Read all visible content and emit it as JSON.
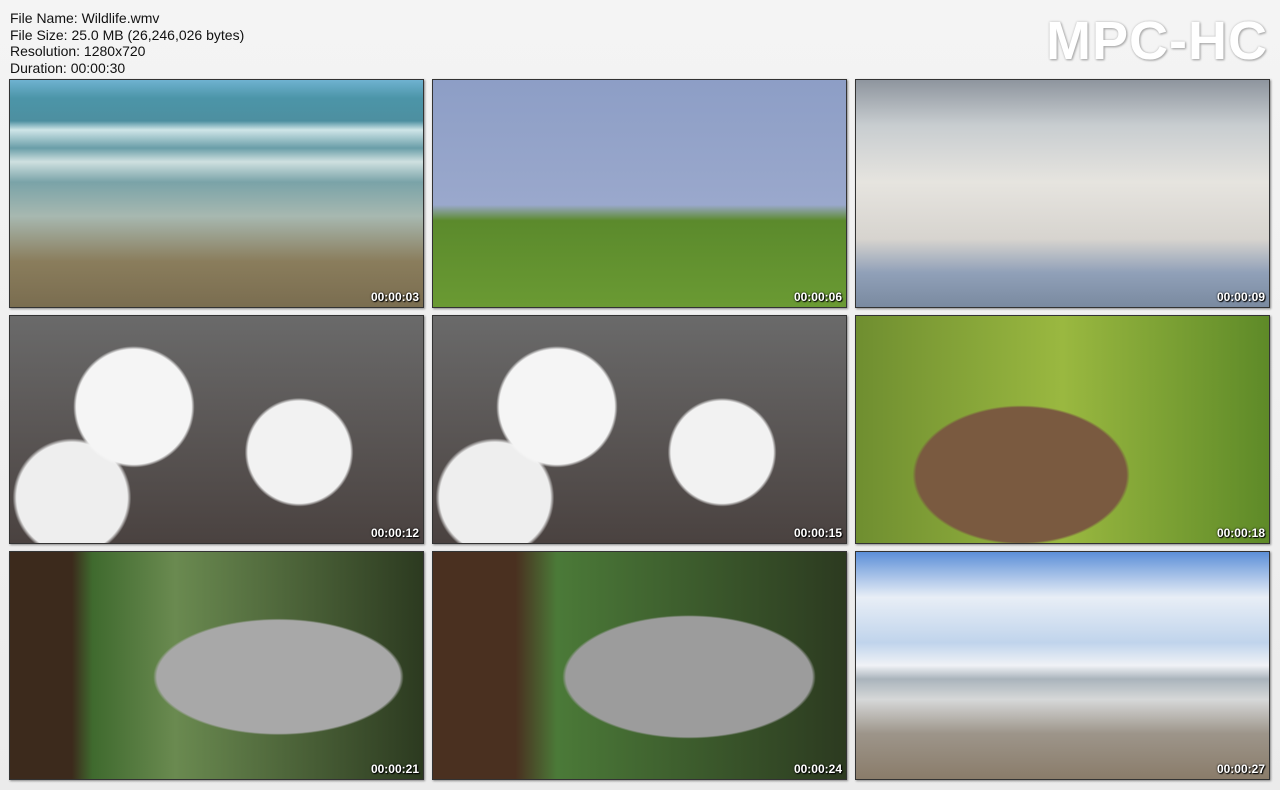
{
  "info": {
    "file_name": "File Name: Wildlife.wmv",
    "file_size": "File Size: 25.0 MB (26,246,026 bytes)",
    "resolution": "Resolution: 1280x720",
    "duration": "Duration: 00:00:30"
  },
  "logo": "MPC-HC",
  "thumbnails": [
    {
      "time": "00:00:03"
    },
    {
      "time": "00:00:06"
    },
    {
      "time": "00:00:09"
    },
    {
      "time": "00:00:12"
    },
    {
      "time": "00:00:15"
    },
    {
      "time": "00:00:18"
    },
    {
      "time": "00:00:21"
    },
    {
      "time": "00:00:24"
    },
    {
      "time": "00:00:27"
    }
  ]
}
